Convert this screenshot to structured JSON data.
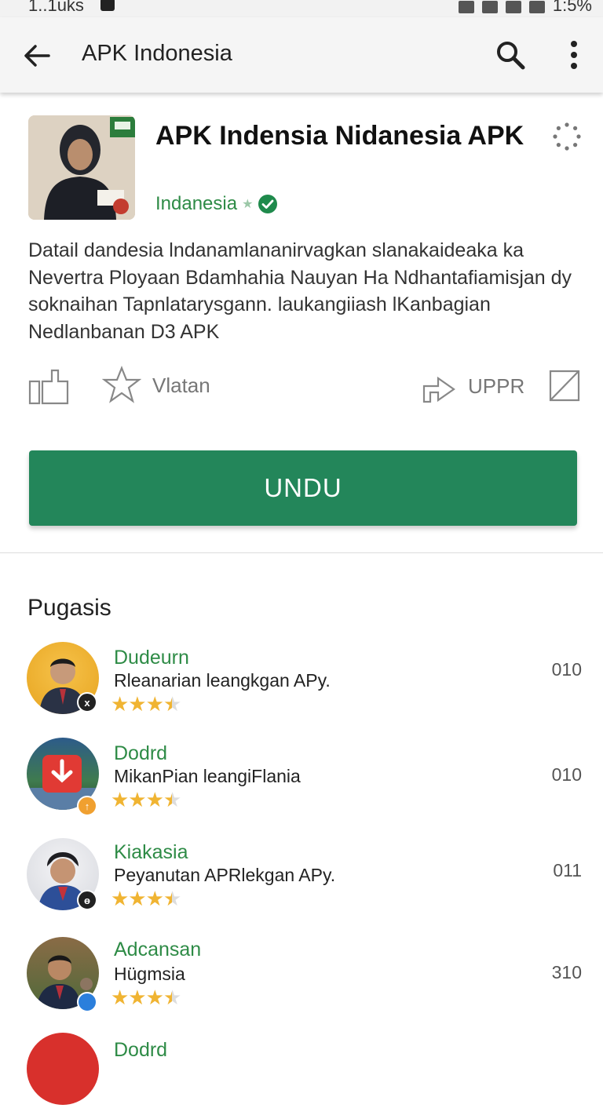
{
  "status": {
    "time": "1..1uks",
    "battery": "1:5%"
  },
  "app_bar": {
    "title": "APK Indonesia",
    "back_icon": "arrow-left-icon",
    "search_icon": "search-icon",
    "menu_icon": "more-vert-icon"
  },
  "app": {
    "name": "APK Indensia Nidanesia APK",
    "developer": "Indanesia",
    "description": "Datail dandesia lndanamlananirvagkan slanakaideaka ka Nevertra Ployaan Bdamhahia Nauyan Ha Ndhantafiamisjan dy soknaihan Tapnlatarysgann. laukangiiash lKanbagian Nedlanbanan D3 APK"
  },
  "actions": {
    "rate_label": "Vlatan",
    "share_label": "UPPR"
  },
  "install_button": {
    "label": "UNDU"
  },
  "reviews_section": {
    "title": "Pugasis"
  },
  "reviews": [
    {
      "name": "Dudeurn",
      "text": "Rleanarian leangkgan APy.",
      "count": "010",
      "rating": 3.5,
      "badge": "x"
    },
    {
      "name": "Dodrd",
      "text": "MikanPian leangiFlania",
      "count": "010",
      "rating": 3.5,
      "badge": "↑"
    },
    {
      "name": "Kiakasia",
      "text": "Peyanutan APRlekgan APy.",
      "count": "011",
      "rating": 3.5,
      "badge": "ɵ"
    },
    {
      "name": "Adcansan",
      "text": "Hügmsia",
      "count": "310",
      "rating": 3.5,
      "badge": ""
    },
    {
      "name": "Dodrd",
      "text": "",
      "count": "",
      "rating": 0,
      "badge": ""
    }
  ],
  "colors": {
    "accent_green": "#23865a",
    "name_green": "#2e8b46",
    "star": "#f0b432"
  }
}
